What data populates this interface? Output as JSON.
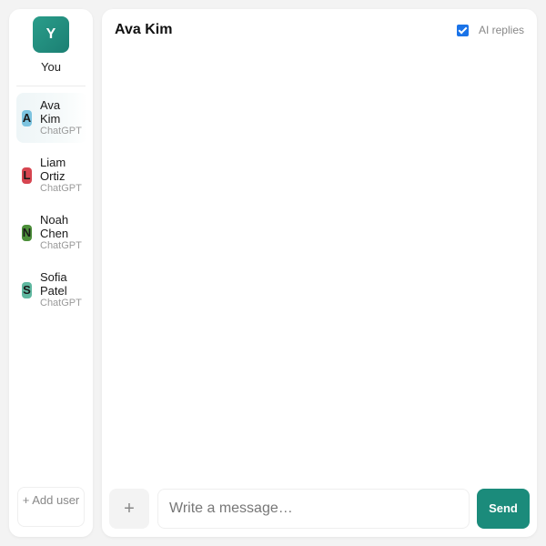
{
  "me": {
    "initial": "Y",
    "name": "You"
  },
  "users": [
    {
      "initial": "A",
      "first": "Ava",
      "last": "Kim",
      "sub": "ChatGPT",
      "color": "#7cc3df",
      "active": true
    },
    {
      "initial": "L",
      "first": "Liam",
      "last": "Ortiz",
      "sub": "ChatGPT",
      "color": "#d64550",
      "active": false
    },
    {
      "initial": "N",
      "first": "Noah",
      "last": "Chen",
      "sub": "ChatGPT",
      "color": "#4c8f3a",
      "active": false
    },
    {
      "initial": "S",
      "first": "Sofia",
      "last": "Patel",
      "sub": "ChatGPT",
      "color": "#5fb8a0",
      "active": false
    }
  ],
  "add_user_label": "+ Add user",
  "chat": {
    "title": "Ava Kim",
    "ai_replies_label": "AI replies",
    "ai_replies_checked": true
  },
  "composer": {
    "attach_label": "+",
    "placeholder": "Write a message…",
    "send_label": "Send"
  }
}
